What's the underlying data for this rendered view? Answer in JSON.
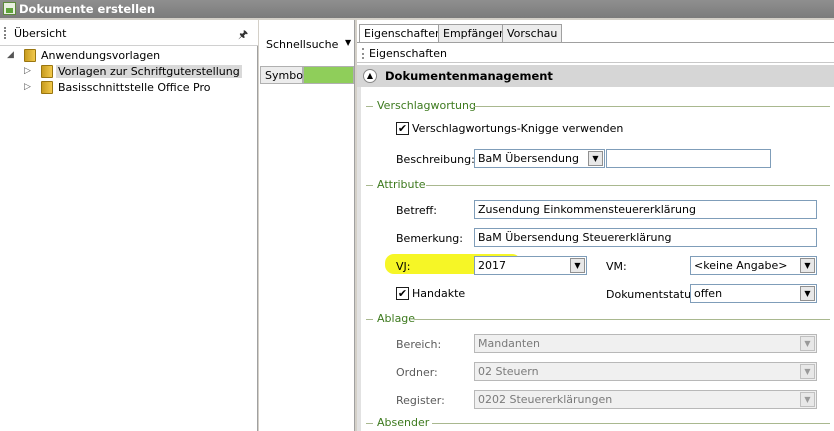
{
  "window": {
    "title": "Dokumente erstellen"
  },
  "left_panel": {
    "header": "Übersicht",
    "tree": [
      {
        "label": "Anwendungsvorlagen",
        "level": 0,
        "expanded": true
      },
      {
        "label": "Vorlagen zur Schriftguterstellung",
        "level": 1,
        "selected": true
      },
      {
        "label": "Basisschnittstelle Office Pro",
        "level": 1
      }
    ]
  },
  "middle_panel": {
    "search_label": "Schnellsuche",
    "column_header": "Symbol"
  },
  "tabs": [
    {
      "label": "Eigenschaften",
      "active": true
    },
    {
      "label": "Empfänger"
    },
    {
      "label": "Vorschau"
    }
  ],
  "subbar_label": "Eigenschaften",
  "section_title": "Dokumentenmanagement",
  "groups": {
    "verschlagwortung": "Verschlagwortung",
    "attribute": "Attribute",
    "ablage": "Ablage",
    "absender": "Absender"
  },
  "fields": {
    "knigge_label": "Verschlagwortungs-Knigge verwenden",
    "knigge_checked": true,
    "beschreibung_label": "Beschreibung:",
    "beschreibung_value": "BaM Übersendung",
    "beschreibung_extra": "",
    "betreff_label": "Betreff:",
    "betreff_value": "Zusendung Einkommensteuererklärung",
    "bemerkung_label": "Bemerkung:",
    "bemerkung_value": "BaM Übersendung Steuererklärung",
    "vj_label": "VJ:",
    "vj_value": "2017",
    "vm_label": "VM:",
    "vm_value": "<keine Angabe>",
    "handakte_label": "Handakte",
    "handakte_checked": true,
    "dokumentstatus_label": "Dokumentstatus:",
    "dokumentstatus_value": "offen",
    "bereich_label": "Bereich:",
    "bereich_value": "Mandanten",
    "ordner_label": "Ordner:",
    "ordner_value": "02 Steuern",
    "register_label": "Register:",
    "register_value": "0202 Steuererklärungen"
  },
  "glyphs": {
    "check": "✔",
    "arrow_down": "▼",
    "pin": "📌",
    "collapse": "▲",
    "expand_open": "◢",
    "expand_closed": "▷"
  },
  "colors": {
    "group_text": "#3d7a1e",
    "highlight": "#f4f400",
    "symbol_column": "#8fce5a"
  }
}
